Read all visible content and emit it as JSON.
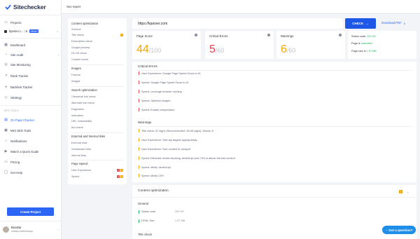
{
  "app": {
    "name": "Sitechecker"
  },
  "sidebar": {
    "projects_label": "Projects",
    "project": {
      "name": "kparser.c... ↓5",
      "badge": "DEMO"
    },
    "items": [
      {
        "label": "Dashboard",
        "icon": "dashboard-icon"
      },
      {
        "label": "Site Audit",
        "icon": "audit-icon"
      },
      {
        "label": "Site Monitoring",
        "icon": "monitoring-icon"
      },
      {
        "label": "Rank Tracker",
        "icon": "rank-icon"
      },
      {
        "label": "Backlink Tracker",
        "icon": "backlink-icon"
      },
      {
        "label": "Strategy",
        "icon": "strategy-icon"
      }
    ],
    "tools_label": "SEO TOOLS",
    "tools": [
      {
        "label": "On Page Checker",
        "icon": "page-icon"
      },
      {
        "label": "Mini SEO Tools",
        "icon": "tools-icon"
      },
      {
        "label": "Notifications",
        "icon": "bell-icon"
      },
      {
        "label": "Watch a Quick Guide",
        "icon": "play-icon"
      },
      {
        "label": "Pricing",
        "icon": "pricing-icon"
      },
      {
        "label": "Get Help",
        "icon": "help-icon"
      }
    ],
    "create_project": "Create Project",
    "user": {
      "name": "Boostia",
      "email": "natalya.fralborekaya..."
    }
  },
  "topbar": {
    "title": "Seo report"
  },
  "left_nav": {
    "content_optimization": "Content optimization",
    "content_items": [
      "General",
      "Title check",
      "Description check",
      "Google preview",
      "H1-H6 check",
      "Content check"
    ],
    "images": "Images",
    "images_items": [
      "Favicon",
      "Images"
    ],
    "search_optimization": "Search optimization",
    "search_items": [
      "Canonical link check",
      "Alternate link check",
      "Pagination",
      "Indexation",
      "URL Vulnerability",
      "Bot check"
    ],
    "external": "External and Internal links",
    "external_items": [
      "External links",
      "Subdomain links",
      "Internal links"
    ],
    "page_speed": "Page Speed",
    "page_speed_items": [
      "User Experience",
      "Speed"
    ],
    "title_badge": "1",
    "ux_badges": [
      "1",
      "1"
    ],
    "speed_badges": [
      "4",
      "4"
    ]
  },
  "url_bar": {
    "value": "https://kparser.com",
    "check_label": "CHECK",
    "pdf_label": "Download PDF"
  },
  "scores": {
    "page_score": {
      "label": "Page Score",
      "value": "44",
      "max": "/100"
    },
    "critical": {
      "label": "Critical Errors",
      "value": "5",
      "max": "/60"
    },
    "warnings": {
      "label": "Warnings",
      "value": "6",
      "max": "/60"
    }
  },
  "status": {
    "status_code_label": "Status code:",
    "status_code": "200 OK",
    "page_label": "Page is",
    "page_value": "Indexable",
    "size_label": "Page size is",
    "size_value": "1.57 MB"
  },
  "critical_errors": {
    "title": "Critical Errors",
    "items": [
      "User Experience: Google Page Speed Score is 44",
      "Speed: Google Page Speed Score is 44",
      "Speed: Leverage browser caching",
      "Speed: Optimize images",
      "Speed: Enable compression"
    ]
  },
  "warnings": {
    "title": "Warnings",
    "items": [
      "Title check: 67 signs (Recommended: 35-65 signs). Words: 8",
      "User Experience: Size tap targets appropriately",
      "User Experience: Size content to viewport",
      "Speed: Eliminate render-blocking JavaScript and CSS in above-the-fold content",
      "Speed: Minify JavaScript",
      "Speed: Minify CSS"
    ]
  },
  "content_opt": {
    "title": "Content optimization",
    "badge": "1",
    "general": "General",
    "status_code_label": "Status code",
    "status_code_value": "200 OK",
    "html_size_label": "HTML Size",
    "html_size_value": "1.57 MB",
    "title_check": "Title check"
  },
  "help_button": "Got a question?",
  "colors": {
    "accent": "#2d66f5",
    "red": "#e8414e",
    "orange": "#f7a600",
    "green": "#22b55f"
  }
}
